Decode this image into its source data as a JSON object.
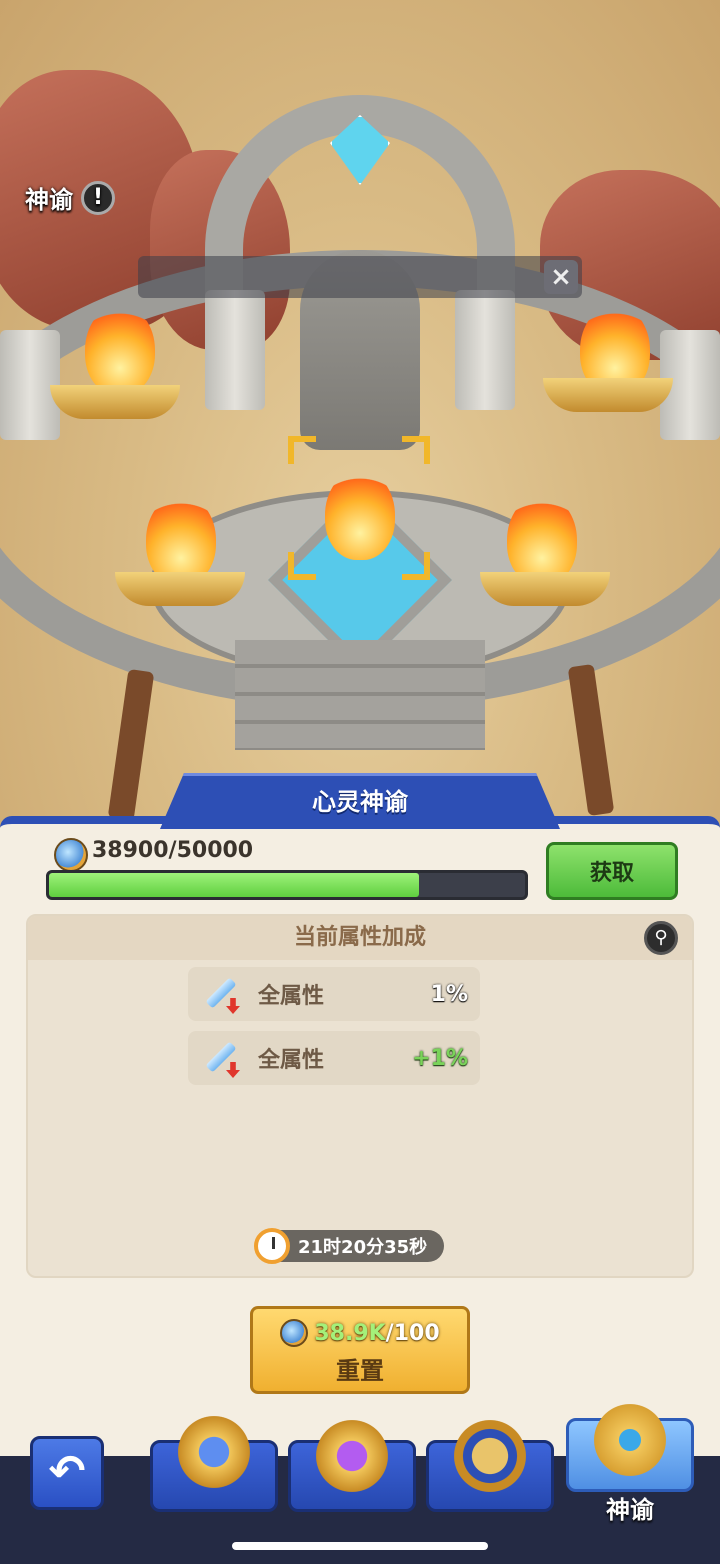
{
  "scene": {
    "oracle_label": "神谕",
    "alert_icon": "exclamation-icon",
    "close_icon": "close-icon"
  },
  "panel": {
    "title": "心灵神谕",
    "resource": {
      "icon": "oracle-crystal-icon",
      "text": "38900/50000",
      "current": 38900,
      "max": 50000
    },
    "get_button": "获取",
    "attributes": {
      "heading": "当前属性加成",
      "magnify_icon": "magnify-icon",
      "rows": [
        {
          "icon": "sword-down-icon",
          "name": "全属性",
          "value": "1%"
        },
        {
          "icon": "sword-down-icon",
          "name": "全属性",
          "value": "+1%"
        }
      ]
    },
    "timer": {
      "icon": "clock-icon",
      "text": "21时20分35秒"
    },
    "reset": {
      "cost_amount": "38.9K",
      "cost_rest": "/100",
      "label": "重置"
    }
  },
  "nav": {
    "back_icon": "back-arrow-icon",
    "tabs": [
      {
        "icon": "blue-orb-compass-icon"
      },
      {
        "icon": "purple-orb-emblem-icon"
      },
      {
        "icon": "golden-angel-emblem-icon"
      },
      {
        "icon": "oracle-statue-icon",
        "label": "神谕",
        "active": true
      }
    ]
  },
  "colors": {
    "accent": "#2d4fb5",
    "progress": "#5fcf3f",
    "get_button": "#4dbb3a",
    "reset_button": "#f0b030"
  }
}
